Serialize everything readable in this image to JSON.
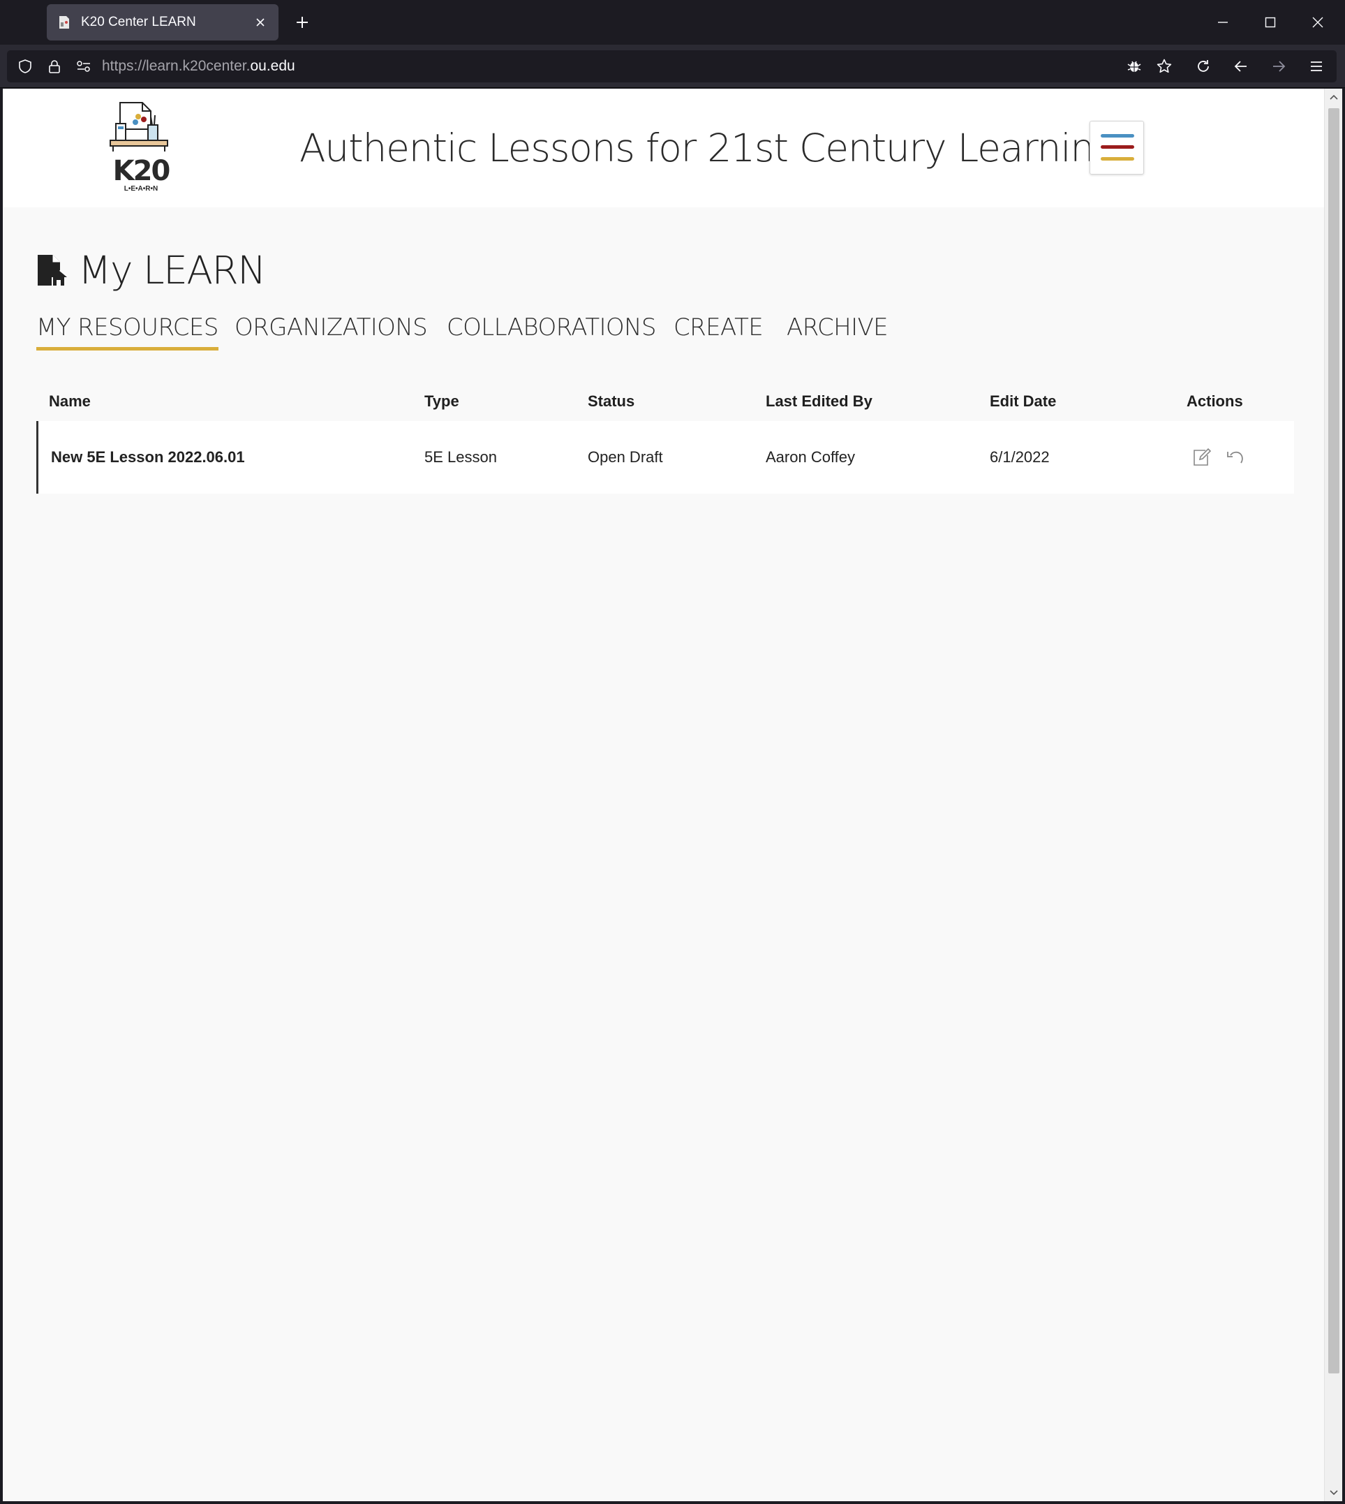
{
  "browser": {
    "tab_title": "K20 Center LEARN",
    "url_prefix": "https://learn.k20center.",
    "url_domain": "ou.edu"
  },
  "header": {
    "logo_text": "K20",
    "logo_subtext": "L•E•A•R•N",
    "title": "Authentic Lessons for 21st Century Learning",
    "menu_colors": [
      "#4a90c2",
      "#9b1c1c",
      "#d9ae3b"
    ]
  },
  "page": {
    "heading": "My LEARN",
    "tabs": [
      {
        "label": "MY RESOURCES",
        "active": true
      },
      {
        "label": "ORGANIZATIONS",
        "active": false
      },
      {
        "label": "COLLABORATIONS",
        "active": false
      },
      {
        "label": "CREATE",
        "active": false
      },
      {
        "label": "ARCHIVE",
        "active": false
      }
    ]
  },
  "table": {
    "columns": [
      "Name",
      "Type",
      "Status",
      "Last Edited By",
      "Edit Date",
      "Actions"
    ],
    "rows": [
      {
        "name": "New 5E Lesson 2022.06.01",
        "type": "5E Lesson",
        "status": "Open Draft",
        "last_edited_by": "Aaron Coffey",
        "edit_date": "6/1/2022",
        "actions": [
          "edit-icon",
          "revert-icon"
        ]
      }
    ]
  },
  "colors": {
    "accent": "#d9ae3b",
    "page_bg": "#f9f9f9"
  }
}
